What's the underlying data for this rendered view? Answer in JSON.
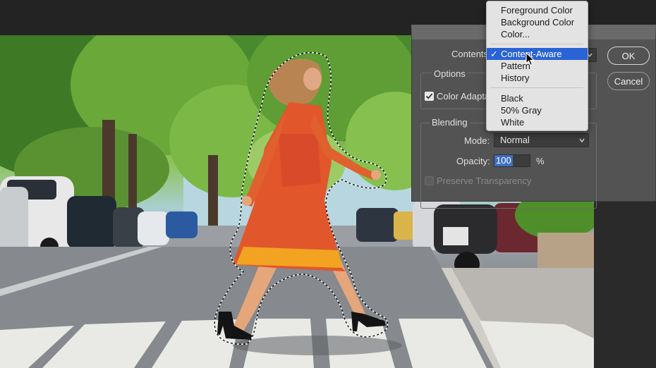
{
  "dialog": {
    "contents_label": "Contents:",
    "ok_label": "OK",
    "cancel_label": "Cancel",
    "options_title": "Options",
    "color_adaptation_label": "Color Adapta",
    "color_adaptation_checked": true,
    "blending_title": "Blending",
    "mode_label": "Mode:",
    "mode_value": "Normal",
    "opacity_label": "Opacity:",
    "opacity_value": "100",
    "opacity_unit": "%",
    "preserve_transparency_label": "Preserve Transparency",
    "preserve_transparency_enabled": false
  },
  "contents_menu": {
    "items": [
      {
        "label": "Foreground Color"
      },
      {
        "label": "Background Color"
      },
      {
        "label": "Color..."
      },
      {
        "label": "Content-Aware",
        "selected": true,
        "check": "✓"
      },
      {
        "label": "Pattern"
      },
      {
        "label": "History"
      },
      {
        "label": "Black"
      },
      {
        "label": "50% Gray"
      },
      {
        "label": "White"
      }
    ]
  },
  "colors": {
    "dialog_bg": "#535353",
    "menu_bg": "#e3e3e3",
    "menu_highlight": "#2a63d6",
    "text_selection": "#3f6fc4"
  },
  "icons": {
    "dropdown": "chevron-down-icon",
    "cursor": "mouse-pointer-icon",
    "checkbox": "checkmark-icon"
  }
}
